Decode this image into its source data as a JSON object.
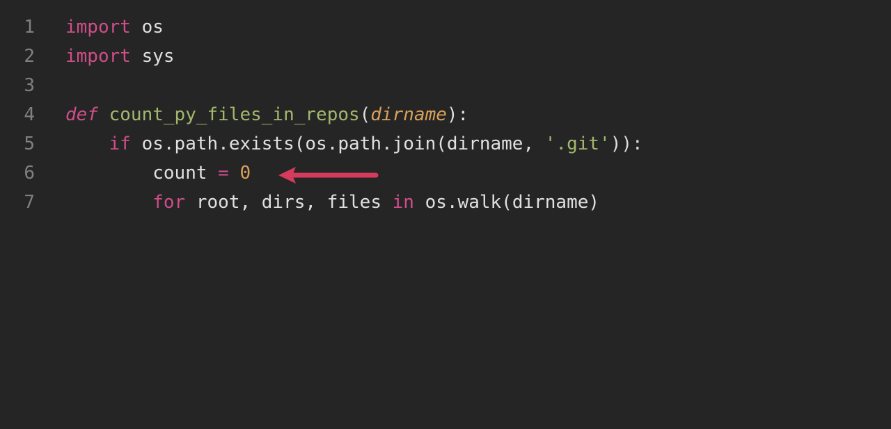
{
  "gutter": {
    "lines": [
      "1",
      "2",
      "3",
      "4",
      "5",
      "6",
      "7"
    ]
  },
  "code": {
    "line1": {
      "kw": "import",
      "sp": " ",
      "mod": "os"
    },
    "line2": {
      "kw": "import",
      "sp": " ",
      "mod": "sys"
    },
    "line3": {
      "blank": ""
    },
    "line4": {
      "kw_def": "def",
      "sp1": " ",
      "fn": "count_py_files_in_repos",
      "lparen": "(",
      "param": "dirname",
      "rparen_colon": "):"
    },
    "line5": {
      "indent": "    ",
      "kw_if": "if",
      "sp1": " ",
      "expr1": "os.path.exists(os.path.join(dirname,",
      "sp2": " ",
      "str": "'.git'",
      "expr2": ")):"
    },
    "line6": {
      "indent": "        ",
      "var": "count",
      "sp1": " ",
      "eq": "=",
      "sp2": " ",
      "num": "0"
    },
    "line7": {
      "indent": "        ",
      "kw_for": "for",
      "sp1": " ",
      "vars": "root, dirs, files",
      "sp2": " ",
      "kw_in": "in",
      "sp3": " ",
      "expr": "os.walk(dirname)"
    }
  },
  "annotation": {
    "arrow_color": "#d43b5c"
  }
}
